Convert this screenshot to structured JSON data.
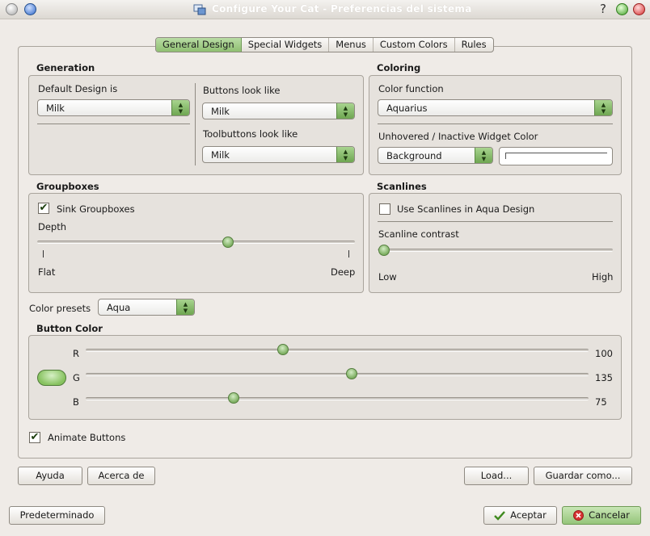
{
  "window": {
    "title": "Configure Your Cat - Preferencias del sistema",
    "help_glyph": "?"
  },
  "tabs": [
    {
      "label": "General Design",
      "active": true
    },
    {
      "label": "Special Widgets",
      "active": false
    },
    {
      "label": "Menus",
      "active": false
    },
    {
      "label": "Custom Colors",
      "active": false
    },
    {
      "label": "Rules",
      "active": false
    }
  ],
  "generation": {
    "title": "Generation",
    "default_design_label": "Default Design is",
    "default_design_value": "Milk",
    "buttons_look_label": "Buttons look like",
    "buttons_look_value": "Milk",
    "toolbuttons_look_label": "Toolbuttons look like",
    "toolbuttons_look_value": "Milk"
  },
  "coloring": {
    "title": "Coloring",
    "color_function_label": "Color function",
    "color_function_value": "Aquarius",
    "unhovered_label": "Unhovered / Inactive Widget Color",
    "unhovered_value": "Background"
  },
  "groupboxes": {
    "title": "Groupboxes",
    "sink_label": "Sink Groupboxes",
    "sink_checked": true,
    "depth_label": "Depth",
    "depth_value": 0.6,
    "min_label": "Flat",
    "max_label": "Deep"
  },
  "scanlines": {
    "title": "Scanlines",
    "use_label": "Use Scanlines in Aqua Design",
    "use_checked": false,
    "contrast_label": "Scanline contrast",
    "contrast_value": 0.0,
    "min_label": "Low",
    "max_label": "High"
  },
  "presets": {
    "label": "Color presets",
    "value": "Aqua"
  },
  "button_color": {
    "title": "Button Color",
    "channels": [
      {
        "label": "R",
        "value": "100"
      },
      {
        "label": "G",
        "value": "135"
      },
      {
        "label": "B",
        "value": "75"
      }
    ],
    "max": 255,
    "swatch_color": "#87c25f"
  },
  "animate": {
    "label": "Animate Buttons",
    "checked": true
  },
  "buttons": {
    "help": "Ayuda",
    "about": "Acerca de",
    "load": "Load...",
    "save_as": "Guardar como...",
    "defaults": "Predeterminado",
    "ok": "Aceptar",
    "cancel": "Cancelar"
  },
  "colors": {
    "accent": "#8fbf72",
    "background": "#efebe7",
    "title_text": "#ffffff"
  },
  "check_glyph": "✔"
}
